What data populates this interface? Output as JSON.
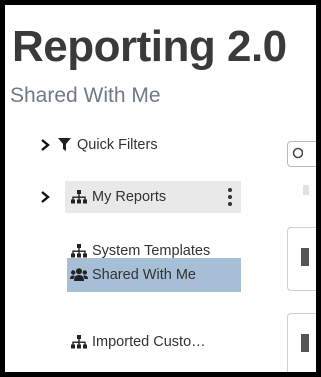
{
  "app": {
    "title": "Reporting 2.0",
    "subtitle": "Shared With Me"
  },
  "sidebar": {
    "items": [
      {
        "label": "Quick Filters",
        "icon": "filter-icon",
        "expandable": true
      },
      {
        "label": "My Reports",
        "icon": "sitemap-icon",
        "expandable": true,
        "has_menu": true
      },
      {
        "label": "System Templates",
        "icon": "sitemap-icon"
      },
      {
        "label": "Shared With Me",
        "icon": "users-icon",
        "selected": true
      },
      {
        "label": "Imported Custo…",
        "icon": "sitemap-icon"
      }
    ]
  },
  "colors": {
    "selected_bg": "#a7bfd6",
    "hover_bg": "#e9e9e9",
    "subtitle": "#6e7a88",
    "frame": "#000000"
  }
}
